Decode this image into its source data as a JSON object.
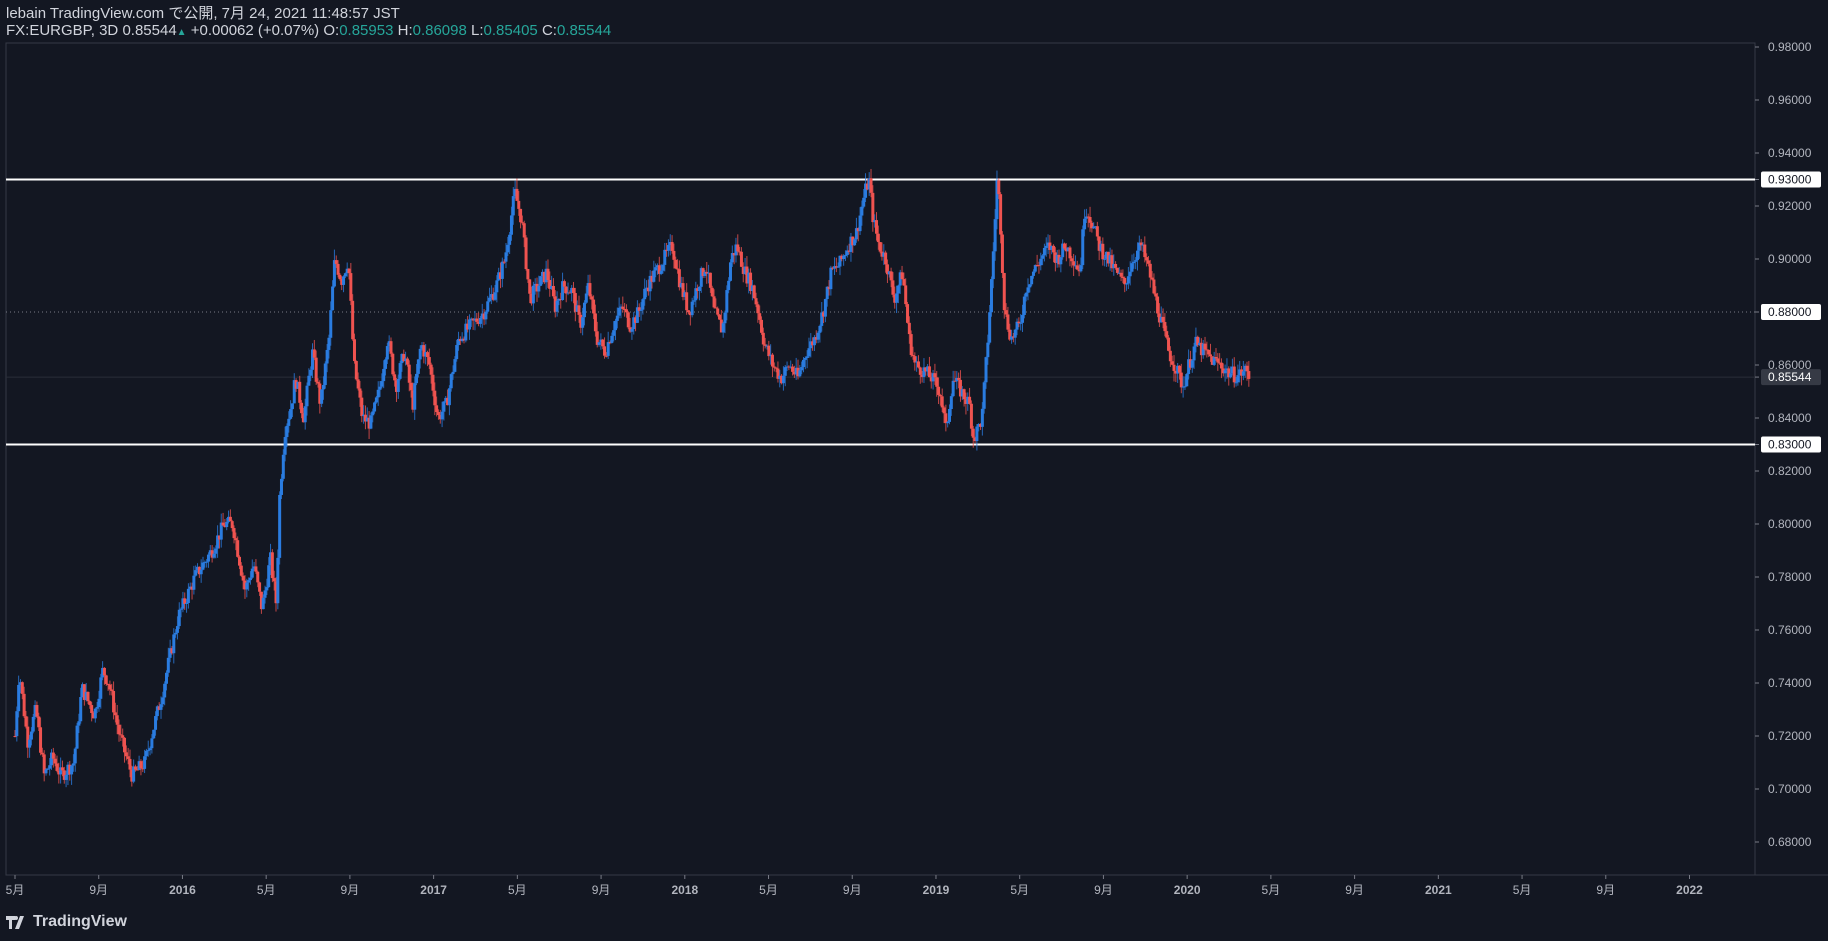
{
  "header": {
    "line1": "lebain TradingView.com で公開, 7月 24, 2021 11:48:57 JST",
    "symbol": "FX:EURGBP, 3D",
    "last": "0.85544",
    "arrow": "▲",
    "change": "+0.00062 (+0.07%)",
    "o_label": "O:",
    "o_val": "0.85953",
    "h_label": "H:",
    "h_val": "0.86098",
    "l_label": "L:",
    "l_val": "0.85405",
    "c_label": "C:",
    "c_val": "0.85544"
  },
  "brand": {
    "name": "TradingView",
    "logo_icon": "tradingview-logo-icon"
  },
  "colors": {
    "bg": "#131722",
    "up": "#2a7ce0",
    "down": "#ef5350",
    "text": "#d1d4dc",
    "value": "#26a69a"
  },
  "chart_data": {
    "type": "candlestick",
    "symbol": "FX:EURGBP",
    "interval": "3D",
    "ylim": [
      0.67,
      0.985
    ],
    "y_ticks": [
      "0.98000",
      "0.96000",
      "0.94000",
      "0.93000",
      "0.92000",
      "0.90000",
      "0.88000",
      "0.86000",
      "0.85544",
      "0.84000",
      "0.83000",
      "0.82000",
      "0.80000",
      "0.78000",
      "0.76000",
      "0.74000",
      "0.72000",
      "0.70000",
      "0.68000"
    ],
    "x_ticks": [
      "5月",
      "9月",
      "2016",
      "5月",
      "9月",
      "2017",
      "5月",
      "9月",
      "2018",
      "5月",
      "9月",
      "2019",
      "5月",
      "9月",
      "2020",
      "5月",
      "9月",
      "2021",
      "5月",
      "9月",
      "2022"
    ],
    "horizontal_lines": [
      {
        "label": "0.93000",
        "value": 0.93,
        "style": "solid"
      },
      {
        "label": "0.83000",
        "value": 0.83,
        "style": "solid"
      },
      {
        "label": "0.88000",
        "value": 0.88,
        "style": "dotted"
      }
    ],
    "last_price": {
      "label": "0.85544",
      "value": 0.85544
    },
    "price_path": [
      [
        0.0,
        0.72
      ],
      [
        0.05,
        0.745
      ],
      [
        0.15,
        0.718
      ],
      [
        0.25,
        0.73
      ],
      [
        0.35,
        0.705
      ],
      [
        0.45,
        0.712
      ],
      [
        0.55,
        0.705
      ],
      [
        0.7,
        0.71
      ],
      [
        0.8,
        0.738
      ],
      [
        0.95,
        0.728
      ],
      [
        1.05,
        0.745
      ],
      [
        1.12,
        0.74
      ],
      [
        1.25,
        0.72
      ],
      [
        1.4,
        0.705
      ],
      [
        1.55,
        0.71
      ],
      [
        1.75,
        0.735
      ],
      [
        1.95,
        0.765
      ],
      [
        2.15,
        0.78
      ],
      [
        2.35,
        0.79
      ],
      [
        2.5,
        0.8
      ],
      [
        2.6,
        0.8
      ],
      [
        2.75,
        0.775
      ],
      [
        2.85,
        0.785
      ],
      [
        2.95,
        0.768
      ],
      [
        3.05,
        0.787
      ],
      [
        3.12,
        0.77
      ],
      [
        3.16,
        0.81
      ],
      [
        3.22,
        0.835
      ],
      [
        3.3,
        0.845
      ],
      [
        3.35,
        0.855
      ],
      [
        3.45,
        0.84
      ],
      [
        3.55,
        0.865
      ],
      [
        3.65,
        0.845
      ],
      [
        3.75,
        0.87
      ],
      [
        3.82,
        0.9
      ],
      [
        3.9,
        0.892
      ],
      [
        3.98,
        0.9
      ],
      [
        4.05,
        0.86
      ],
      [
        4.15,
        0.84
      ],
      [
        4.25,
        0.838
      ],
      [
        4.35,
        0.85
      ],
      [
        4.45,
        0.87
      ],
      [
        4.55,
        0.852
      ],
      [
        4.65,
        0.865
      ],
      [
        4.75,
        0.845
      ],
      [
        4.85,
        0.868
      ],
      [
        4.95,
        0.86
      ],
      [
        5.05,
        0.84
      ],
      [
        5.15,
        0.845
      ],
      [
        5.3,
        0.87
      ],
      [
        5.45,
        0.875
      ],
      [
        5.6,
        0.88
      ],
      [
        5.75,
        0.89
      ],
      [
        5.85,
        0.9
      ],
      [
        5.97,
        0.925
      ],
      [
        6.05,
        0.915
      ],
      [
        6.1,
        0.9
      ],
      [
        6.15,
        0.885
      ],
      [
        6.25,
        0.89
      ],
      [
        6.35,
        0.895
      ],
      [
        6.45,
        0.882
      ],
      [
        6.55,
        0.89
      ],
      [
        6.65,
        0.888
      ],
      [
        6.75,
        0.875
      ],
      [
        6.85,
        0.89
      ],
      [
        6.95,
        0.87
      ],
      [
        7.05,
        0.865
      ],
      [
        7.15,
        0.875
      ],
      [
        7.25,
        0.882
      ],
      [
        7.35,
        0.875
      ],
      [
        7.45,
        0.88
      ],
      [
        7.55,
        0.89
      ],
      [
        7.65,
        0.895
      ],
      [
        7.75,
        0.9
      ],
      [
        7.85,
        0.905
      ],
      [
        7.95,
        0.89
      ],
      [
        8.05,
        0.88
      ],
      [
        8.15,
        0.89
      ],
      [
        8.25,
        0.898
      ],
      [
        8.35,
        0.88
      ],
      [
        8.45,
        0.873
      ],
      [
        8.55,
        0.9
      ],
      [
        8.62,
        0.905
      ],
      [
        8.72,
        0.895
      ],
      [
        8.8,
        0.89
      ],
      [
        8.88,
        0.88
      ],
      [
        8.95,
        0.868
      ],
      [
        9.05,
        0.86
      ],
      [
        9.15,
        0.855
      ],
      [
        9.25,
        0.86
      ],
      [
        9.35,
        0.855
      ],
      [
        9.45,
        0.865
      ],
      [
        9.55,
        0.87
      ],
      [
        9.65,
        0.88
      ],
      [
        9.75,
        0.895
      ],
      [
        9.85,
        0.898
      ],
      [
        9.95,
        0.905
      ],
      [
        10.05,
        0.91
      ],
      [
        10.15,
        0.925
      ],
      [
        10.2,
        0.93
      ],
      [
        10.25,
        0.915
      ],
      [
        10.32,
        0.905
      ],
      [
        10.4,
        0.9
      ],
      [
        10.5,
        0.885
      ],
      [
        10.6,
        0.895
      ],
      [
        10.68,
        0.87
      ],
      [
        10.75,
        0.86
      ],
      [
        10.85,
        0.858
      ],
      [
        10.95,
        0.855
      ],
      [
        11.05,
        0.85
      ],
      [
        11.12,
        0.835
      ],
      [
        11.2,
        0.855
      ],
      [
        11.3,
        0.85
      ],
      [
        11.4,
        0.845
      ],
      [
        11.45,
        0.832
      ],
      [
        11.55,
        0.84
      ],
      [
        11.62,
        0.87
      ],
      [
        11.68,
        0.9
      ],
      [
        11.73,
        0.93
      ],
      [
        11.76,
        0.92
      ],
      [
        11.82,
        0.88
      ],
      [
        11.9,
        0.87
      ],
      [
        12.0,
        0.875
      ],
      [
        12.08,
        0.89
      ],
      [
        12.16,
        0.895
      ],
      [
        12.25,
        0.9
      ],
      [
        12.35,
        0.905
      ],
      [
        12.45,
        0.9
      ],
      [
        12.55,
        0.905
      ],
      [
        12.65,
        0.9
      ],
      [
        12.72,
        0.895
      ],
      [
        12.78,
        0.92
      ],
      [
        12.85,
        0.915
      ],
      [
        12.95,
        0.905
      ],
      [
        13.05,
        0.9
      ],
      [
        13.15,
        0.895
      ],
      [
        13.25,
        0.89
      ],
      [
        13.35,
        0.9
      ],
      [
        13.45,
        0.905
      ],
      [
        13.55,
        0.895
      ],
      [
        13.62,
        0.885
      ],
      [
        13.7,
        0.875
      ],
      [
        13.78,
        0.865
      ],
      [
        13.85,
        0.86
      ],
      [
        13.95,
        0.852
      ],
      [
        14.02,
        0.86
      ],
      [
        14.1,
        0.868
      ],
      [
        14.2,
        0.865
      ],
      [
        14.3,
        0.862
      ],
      [
        14.4,
        0.86
      ],
      [
        14.5,
        0.857
      ],
      [
        14.6,
        0.856
      ],
      [
        14.7,
        0.858
      ],
      [
        14.75,
        0.85544
      ]
    ]
  }
}
